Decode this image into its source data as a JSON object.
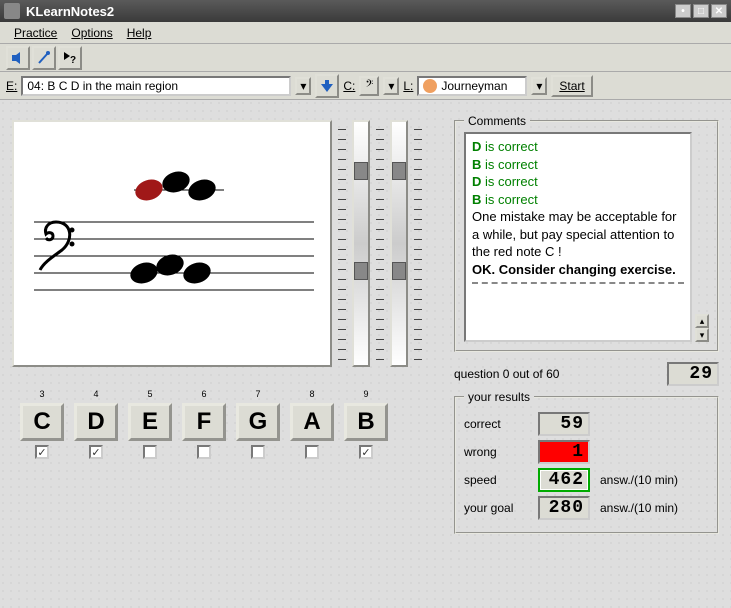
{
  "window": {
    "title": "KLearnNotes2"
  },
  "menu": {
    "practice": "Practice",
    "options": "Options",
    "help": "Help"
  },
  "toolbar2": {
    "e_label": "E:",
    "exercise": "04: B C D in the main region",
    "c_label": "C:",
    "l_label": "L:",
    "level": "Journeyman",
    "start": "Start"
  },
  "notes": {
    "buttons": [
      "C",
      "D",
      "E",
      "F",
      "G",
      "A",
      "B"
    ],
    "numbers": [
      "3",
      "4",
      "5",
      "6",
      "7",
      "8",
      "9"
    ],
    "checked": [
      true,
      true,
      false,
      false,
      false,
      false,
      true
    ]
  },
  "comments": {
    "title": "Comments",
    "lines": [
      {
        "bold": "D",
        "rest": " is correct",
        "green": true
      },
      {
        "bold": "B",
        "rest": " is correct",
        "green": true
      },
      {
        "bold": "D",
        "rest": " is correct",
        "green": true
      },
      {
        "bold": "B",
        "rest": " is correct",
        "green": true
      },
      {
        "text": "One mistake may be acceptable for a while, but pay special attention to the red note C !"
      },
      {
        "text": "OK. Consider changing exercise.",
        "strong": true
      }
    ]
  },
  "question": {
    "label": "question 0 out of 60",
    "countdown": "29"
  },
  "results": {
    "title": "your results",
    "correct_label": "correct",
    "correct": "59",
    "wrong_label": "wrong",
    "wrong": "1",
    "speed_label": "speed",
    "speed": "462",
    "speed_unit": "answ./(10 min)",
    "goal_label": "your goal",
    "goal": "280",
    "goal_unit": "answ./(10 min)"
  }
}
